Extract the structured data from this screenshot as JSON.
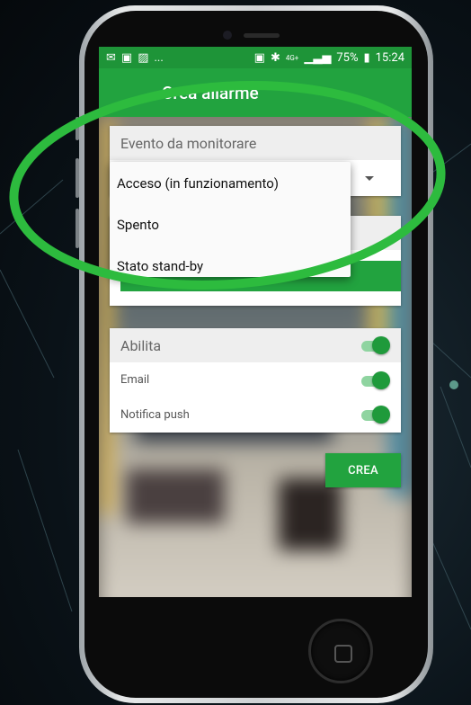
{
  "status_bar": {
    "left_ellipsis": "...",
    "network": "4G+",
    "battery": "75%",
    "time": "15:24"
  },
  "app_bar": {
    "title": "Crea allarme"
  },
  "event_field": {
    "label": "Evento da monitorare",
    "options": [
      "Acceso (in funzionamento)",
      "Spento",
      "Stato stand-by"
    ]
  },
  "notifications": {
    "enable_label": "Abilita",
    "email_label": "Email",
    "push_label": "Notifica push",
    "enable_on": true,
    "email_on": true,
    "push_on": true
  },
  "create_button": {
    "label": "CREA"
  },
  "colors": {
    "accent": "#22a33f",
    "highlight_ring": "#2dbb3e"
  }
}
